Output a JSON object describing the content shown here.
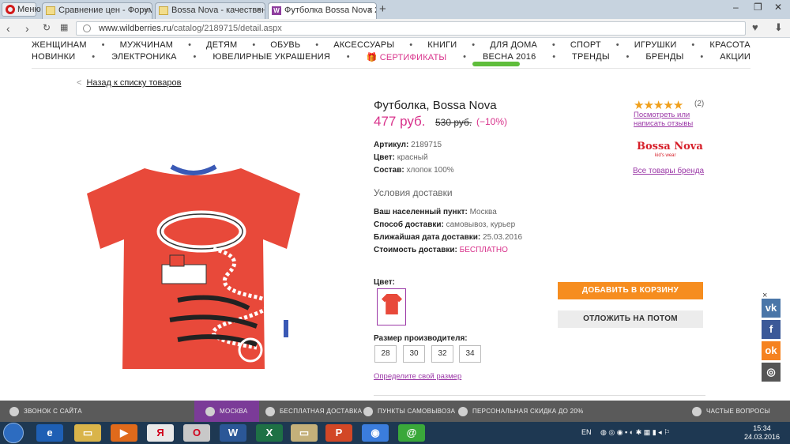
{
  "browser": {
    "menu_label": "Меню",
    "tabs": [
      {
        "title": "Сравнение цен - Форум"
      },
      {
        "title": "Bossa Nova - качественн"
      },
      {
        "title": "Футболка Bossa Nova 2189"
      }
    ],
    "url_domain": "www.wildberries.ru",
    "url_path": "/catalog/2189715/detail.aspx"
  },
  "nav": {
    "row1": [
      "ЖЕНЩИНАМ",
      "МУЖЧИНАМ",
      "ДЕТЯМ",
      "ОБУВЬ",
      "АКСЕССУАРЫ",
      "КНИГИ",
      "ДЛЯ ДОМА",
      "СПОРТ",
      "ИГРУШКИ",
      "КРАСОТА"
    ],
    "row2": [
      "НОВИНКИ",
      "ЭЛЕКТРОНИКА",
      "ЮВЕЛИРНЫЕ УКРАШЕНИЯ",
      "СЕРТИФИКАТЫ",
      "ВЕСНА 2016",
      "ТРЕНДЫ",
      "БРЕНДЫ",
      "АКЦИИ"
    ]
  },
  "back_link": "Назад к списку товаров",
  "product": {
    "title": "Футболка, Bossa Nova",
    "price": "477 руб.",
    "old_price": "530 руб.",
    "discount": "(−10%)",
    "rating_count": "(2)",
    "rating": 5,
    "reviews_link_1": "Посмотреть или",
    "reviews_link_2": "написать отзывы",
    "brand_name": "Bossa Nova",
    "brand_sub": "kid's wear",
    "all_brand_link": "Все товары бренда",
    "article_label": "Артикул:",
    "article": "2189715",
    "color_label": "Цвет:",
    "color": "красный",
    "composition_label": "Состав:",
    "composition": "хлопок 100%"
  },
  "delivery": {
    "heading": "Условия доставки",
    "city_label": "Ваш населенный пункт:",
    "city": "Москва",
    "method_label": "Способ доставки:",
    "method": "самовывоз, курьер",
    "date_label": "Ближайшая дата доставки:",
    "date": "25.03.2016",
    "cost_label": "Стоимость доставки:",
    "cost": "БЕСПЛАТНО"
  },
  "options": {
    "color_label": "Цвет:",
    "size_label": "Размер производителя:",
    "sizes": [
      "28",
      "30",
      "32",
      "34"
    ],
    "size_link": "Определите свой размер"
  },
  "buttons": {
    "add_to_cart": "ДОБАВИТЬ В КОРЗИНУ",
    "save_later": "ОТЛОЖИТЬ НА ПОТОМ"
  },
  "social": {
    "close": "×"
  },
  "footer": {
    "call": "ЗВОНОК С САЙТА",
    "city": "МОСКВА",
    "free_delivery": "БЕСПЛАТНАЯ ДОСТАВКА",
    "pickup": "ПУНКТЫ САМОВЫВОЗА",
    "discount": "ПЕРСОНАЛЬНАЯ СКИДКА ДО 20%",
    "faq": "ЧАСТЫЕ ВОПРОСЫ"
  },
  "taskbar": {
    "lang": "EN",
    "time": "15:34",
    "date": "24.03.2016"
  },
  "colors": {
    "accent": "#d8328b",
    "link": "#9b38a7",
    "cart": "#f68d1f",
    "footer": "#5a5a5a",
    "footer_active": "#7b3b98"
  }
}
